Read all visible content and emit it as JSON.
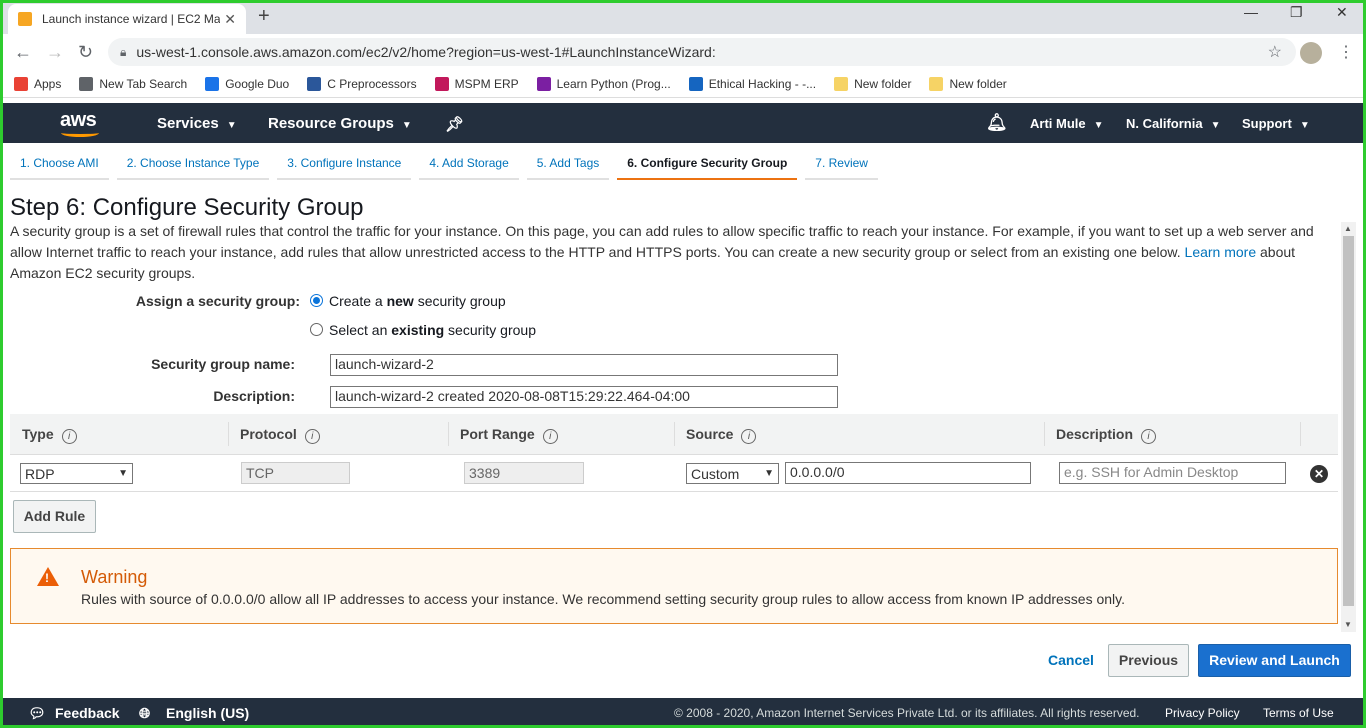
{
  "browser": {
    "tab_title": "Launch instance wizard | EC2 Ma",
    "url": "us-west-1.console.aws.amazon.com/ec2/v2/home?region=us-west-1#LaunchInstanceWizard:",
    "bookmarks": [
      {
        "label": "Apps",
        "icon": "apps-grid-icon",
        "color": "#e94235"
      },
      {
        "label": "New Tab Search",
        "icon": "search-icon",
        "color": "#5f6368"
      },
      {
        "label": "Google Duo",
        "icon": "duo-icon",
        "color": "#1a73e8"
      },
      {
        "label": "C Preprocessors",
        "icon": "w-icon",
        "color": "#2b579a"
      },
      {
        "label": "MSPM ERP",
        "icon": "mspm-icon",
        "color": "#c2185b"
      },
      {
        "label": "Learn Python (Prog...",
        "icon": "python-icon",
        "color": "#7b1fa2"
      },
      {
        "label": "Ethical Hacking - -...",
        "icon": "s-icon",
        "color": "#1565c0"
      },
      {
        "label": "New folder",
        "icon": "folder-icon",
        "color": "#f6d365"
      },
      {
        "label": "New folder",
        "icon": "folder-icon",
        "color": "#f6d365"
      }
    ]
  },
  "aws_header": {
    "logo": "aws",
    "services": "Services",
    "resource_groups": "Resource Groups",
    "user": "Arti Mule",
    "region": "N. California",
    "support": "Support"
  },
  "steps": [
    "1. Choose AMI",
    "2. Choose Instance Type",
    "3. Configure Instance",
    "4. Add Storage",
    "5. Add Tags",
    "6. Configure Security Group",
    "7. Review"
  ],
  "page": {
    "title": "Step 6: Configure Security Group",
    "intro_before": "A security group is a set of firewall rules that control the traffic for your instance. On this page, you can add rules to allow specific traffic to reach your instance. For example, if you want to set up a web server and allow Internet traffic to reach your instance, add rules that allow unrestricted access to the HTTP and HTTPS ports. You can create a new security group or select from an existing one below.",
    "learn_more": "Learn more",
    "intro_after": "about Amazon EC2 security groups."
  },
  "form": {
    "assign_label": "Assign a security group:",
    "option_new_pre": "Create a ",
    "option_new_bold": "new",
    "option_new_post": " security group",
    "option_existing_pre": "Select an ",
    "option_existing_bold": "existing",
    "option_existing_post": " security group",
    "name_label": "Security group name:",
    "name_value": "launch-wizard-2",
    "desc_label": "Description:",
    "desc_value": "launch-wizard-2 created 2020-08-08T15:29:22.464-04:00"
  },
  "table": {
    "headers": [
      "Type",
      "Protocol",
      "Port Range",
      "Source",
      "Description"
    ],
    "rows": [
      {
        "type": "RDP",
        "protocol": "TCP",
        "port_range": "3389",
        "source_mode": "Custom",
        "source_value": "0.0.0.0/0",
        "description_placeholder": "e.g. SSH for Admin Desktop"
      }
    ],
    "add_rule": "Add Rule"
  },
  "warning": {
    "title": "Warning",
    "text": "Rules with source of 0.0.0.0/0 allow all IP addresses to access your instance. We recommend setting security group rules to allow access from known IP addresses only."
  },
  "actions": {
    "cancel": "Cancel",
    "previous": "Previous",
    "review_launch": "Review and Launch"
  },
  "footer": {
    "feedback": "Feedback",
    "language": "English (US)",
    "copyright": "© 2008 - 2020, Amazon Internet Services Private Ltd. or its affiliates. All rights reserved.",
    "privacy": "Privacy Policy",
    "terms": "Terms of Use"
  },
  "colors": {
    "aws_dark": "#232f3e",
    "accent_orange": "#ec7211",
    "link_blue": "#0073bb",
    "primary_button": "#1a70cf",
    "warning_orange": "#d45b07"
  }
}
